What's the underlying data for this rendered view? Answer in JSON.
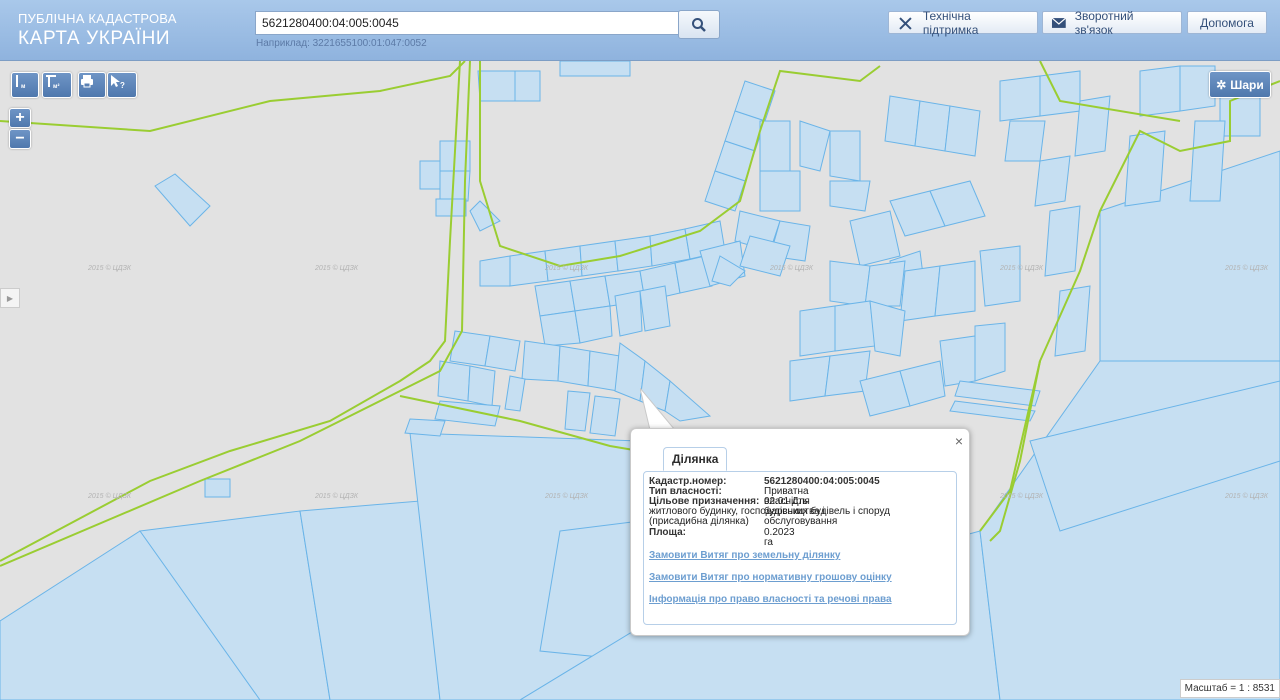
{
  "header": {
    "logo_line1": "ПУБЛІЧНА КАДАСТРОВА",
    "logo_line2": "КАРТА УКРАЇНИ",
    "search_value": "5621280400:04:005:0045",
    "example": "Наприклад: 3221655100:01:047:0052",
    "support_label": "Технічна підтримка",
    "feedback_label": "Зворотний зв'язок",
    "help_label": "Допомога"
  },
  "map": {
    "layers_label": "Шари",
    "zoom_in": "+",
    "zoom_out": "−",
    "watermark": "2015 © ЦДЗК",
    "scale": "Масштаб = 1 : 8531"
  },
  "popup": {
    "tab": "Ділянка",
    "close": "×",
    "cadastre_key": "Кадастр.номер:",
    "cadastre_value": "5621280400:04:005:0045",
    "ownership_key": "Тип власності:",
    "ownership_value": "Приватна власність",
    "purpose_key": "Цільове призначення:",
    "purpose_value": "02.01 Для будівництва і обслуговування",
    "purpose_line2": "житлового будинку, господарських будівель і споруд",
    "purpose_line3": "(присадибна ділянка)",
    "area_key": "Площа:",
    "area_value": "0.2023 га",
    "link1": "Замовити Витяг про земельну ділянку",
    "link2": "Замовити Витяг про нормативну грошову оцінку",
    "link3": "Інформація про право власності та речові права"
  },
  "colors": {
    "parcel_fill": "#c6dff2",
    "parcel_stroke": "#6ab4e8",
    "boundary": "#9acd32",
    "map_bg": "#e2e2e2"
  }
}
